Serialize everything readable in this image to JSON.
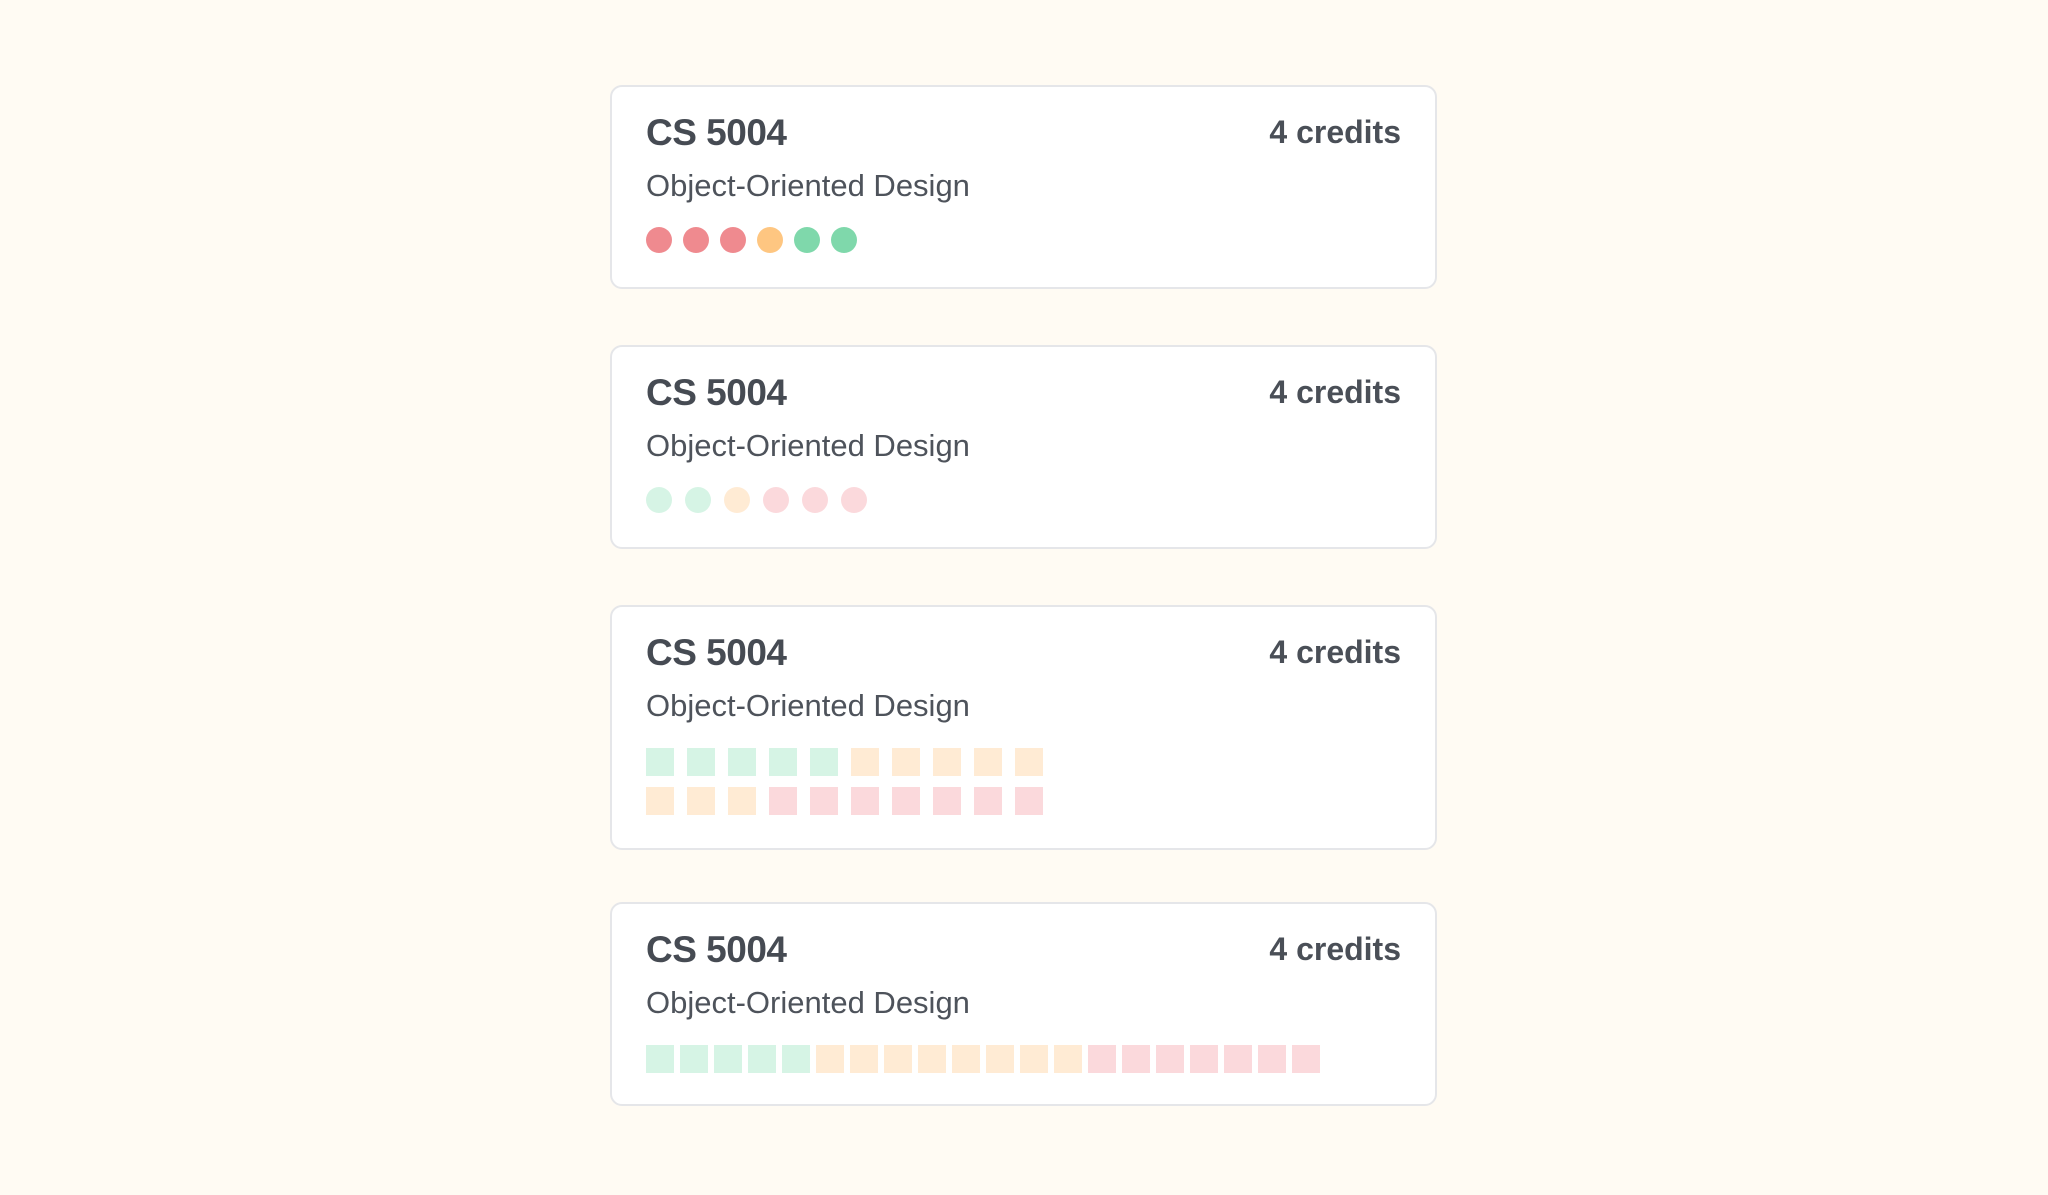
{
  "cards": [
    {
      "code": "CS 5004",
      "credits": "4 credits",
      "name": "Object-Oriented Design",
      "indicator_style": "solid-dots",
      "indicators": [
        {
          "status": "negative",
          "color": "#ef8a8f"
        },
        {
          "status": "negative",
          "color": "#ef8a8f"
        },
        {
          "status": "negative",
          "color": "#ef8a8f"
        },
        {
          "status": "neutral",
          "color": "#fec681"
        },
        {
          "status": "positive",
          "color": "#7fd8ab"
        },
        {
          "status": "positive",
          "color": "#7fd8ab"
        }
      ]
    },
    {
      "code": "CS 5004",
      "credits": "4 credits",
      "name": "Object-Oriented Design",
      "indicator_style": "pale-dots",
      "indicators": [
        {
          "status": "positive",
          "color": "#d6f4e5"
        },
        {
          "status": "positive",
          "color": "#d6f4e5"
        },
        {
          "status": "neutral",
          "color": "#ffebd4"
        },
        {
          "status": "negative",
          "color": "#fbd9dc"
        },
        {
          "status": "negative",
          "color": "#fbd9dc"
        },
        {
          "status": "negative",
          "color": "#fbd9dc"
        }
      ]
    },
    {
      "code": "CS 5004",
      "credits": "4 credits",
      "name": "Object-Oriented Design",
      "indicator_style": "square-grid",
      "rows": [
        [
          {
            "status": "positive",
            "color": "#d6f4e5"
          },
          {
            "status": "positive",
            "color": "#d6f4e5"
          },
          {
            "status": "positive",
            "color": "#d6f4e5"
          },
          {
            "status": "positive",
            "color": "#d6f4e5"
          },
          {
            "status": "positive",
            "color": "#d6f4e5"
          },
          {
            "status": "neutral",
            "color": "#ffebd4"
          },
          {
            "status": "neutral",
            "color": "#ffebd4"
          },
          {
            "status": "neutral",
            "color": "#ffebd4"
          },
          {
            "status": "neutral",
            "color": "#ffebd4"
          },
          {
            "status": "neutral",
            "color": "#ffebd4"
          }
        ],
        [
          {
            "status": "neutral",
            "color": "#ffebd4"
          },
          {
            "status": "neutral",
            "color": "#ffebd4"
          },
          {
            "status": "neutral",
            "color": "#ffebd4"
          },
          {
            "status": "negative",
            "color": "#fbd9dc"
          },
          {
            "status": "negative",
            "color": "#fbd9dc"
          },
          {
            "status": "negative",
            "color": "#fbd9dc"
          },
          {
            "status": "negative",
            "color": "#fbd9dc"
          },
          {
            "status": "negative",
            "color": "#fbd9dc"
          },
          {
            "status": "negative",
            "color": "#fbd9dc"
          },
          {
            "status": "negative",
            "color": "#fbd9dc"
          }
        ]
      ]
    },
    {
      "code": "CS 5004",
      "credits": "4 credits",
      "name": "Object-Oriented Design",
      "indicator_style": "square-strip",
      "indicators": [
        {
          "status": "positive",
          "color": "#d6f4e5"
        },
        {
          "status": "positive",
          "color": "#d6f4e5"
        },
        {
          "status": "positive",
          "color": "#d6f4e5"
        },
        {
          "status": "positive",
          "color": "#d6f4e5"
        },
        {
          "status": "positive",
          "color": "#d6f4e5"
        },
        {
          "status": "neutral",
          "color": "#ffebd4"
        },
        {
          "status": "neutral",
          "color": "#ffebd4"
        },
        {
          "status": "neutral",
          "color": "#ffebd4"
        },
        {
          "status": "neutral",
          "color": "#ffebd4"
        },
        {
          "status": "neutral",
          "color": "#ffebd4"
        },
        {
          "status": "neutral",
          "color": "#ffebd4"
        },
        {
          "status": "neutral",
          "color": "#ffebd4"
        },
        {
          "status": "neutral",
          "color": "#ffebd4"
        },
        {
          "status": "negative",
          "color": "#fbd9dc"
        },
        {
          "status": "negative",
          "color": "#fbd9dc"
        },
        {
          "status": "negative",
          "color": "#fbd9dc"
        },
        {
          "status": "negative",
          "color": "#fbd9dc"
        },
        {
          "status": "negative",
          "color": "#fbd9dc"
        },
        {
          "status": "negative",
          "color": "#fbd9dc"
        },
        {
          "status": "negative",
          "color": "#fbd9dc"
        }
      ]
    }
  ]
}
